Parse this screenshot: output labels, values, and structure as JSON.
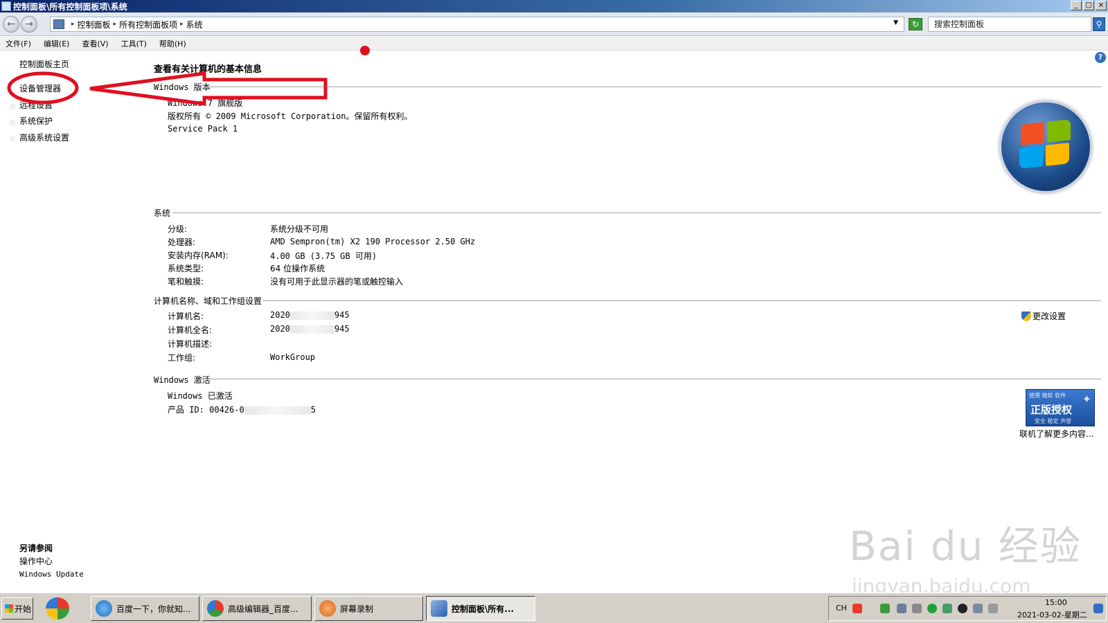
{
  "window": {
    "title": "控制面板\\所有控制面板项\\系统",
    "buttons": [
      "_",
      "□",
      "×"
    ]
  },
  "address": {
    "crumbs": [
      "控制面板",
      "所有控制面板项",
      "系统"
    ],
    "search_placeholder": "搜索控制面板"
  },
  "menu": [
    "文件(F)",
    "编辑(E)",
    "查看(V)",
    "工具(T)",
    "帮助(H)"
  ],
  "left": {
    "home": "控制面板主页",
    "links": [
      "设备管理器",
      "远程设置",
      "系统保护",
      "高级系统设置"
    ],
    "see_also_title": "另请参阅",
    "see_also": [
      "操作中心",
      "Windows Update"
    ]
  },
  "main": {
    "title": "查看有关计算机的基本信息",
    "edition": {
      "header": "Windows 版本",
      "name": "Windows 7 旗舰版",
      "copyright": "版权所有 © 2009 Microsoft Corporation。保留所有权利。",
      "service_pack": "Service Pack 1"
    },
    "system": {
      "header": "系统",
      "rows": [
        {
          "label": "分级:",
          "value": "系统分级不可用"
        },
        {
          "label": "处理器:",
          "value": "AMD Sempron(tm) X2 190 Processor   2.50 GHz"
        },
        {
          "label": "安装内存(RAM):",
          "value": "4.00 GB (3.75 GB 可用)"
        },
        {
          "label": "系统类型:",
          "value": "64 位操作系统"
        },
        {
          "label": "笔和触摸:",
          "value": "没有可用于此显示器的笔或触控输入"
        }
      ]
    },
    "computer": {
      "header": "计算机名称、域和工作组设置",
      "rows": [
        {
          "label": "计算机名:",
          "value": "2020",
          "value_tail": "945"
        },
        {
          "label": "计算机全名:",
          "value": "2020",
          "value_tail": "945"
        },
        {
          "label": "计算机描述:",
          "value": ""
        },
        {
          "label": "工作组:",
          "value": "WorkGroup"
        }
      ],
      "change_settings": "更改设置"
    },
    "activation": {
      "header": "Windows 激活",
      "status": "Windows 已激活",
      "product_id_label": "产品 ID: 00426-0",
      "product_id_tail": "5",
      "genuine_top": "使用 微软 软件",
      "genuine_main": "正版授权",
      "genuine_sub": "安全 稳定 声誉",
      "online_more": "联机了解更多内容..."
    }
  },
  "taskbar": {
    "start": "开始",
    "items": [
      "百度一下，你就知...",
      "高级编辑器_百度...",
      "屏幕录制",
      "控制面板\\所有..."
    ],
    "lang": "CH",
    "time": "15:00",
    "date": "2021-03-02-星期二"
  },
  "watermark": {
    "brand": "Bai du 经验",
    "url": "jingyan.baidu.com"
  },
  "colors": {
    "annotation_red": "#e01020",
    "titlebar_blue": "#0a246a"
  }
}
